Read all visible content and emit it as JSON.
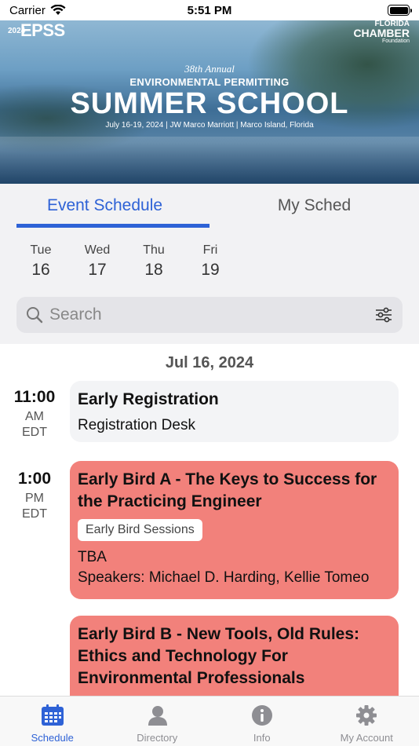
{
  "status_bar": {
    "carrier": "Carrier",
    "time": "5:51 PM"
  },
  "banner": {
    "logo_year": "2024",
    "logo_left": "EPSS",
    "logo_right_line1": "FLORIDA",
    "logo_right_line2": "CHAMBER",
    "logo_right_line3": "Foundation",
    "annual": "38th Annual",
    "subtitle": "ENVIRONMENTAL PERMITTING",
    "title": "SUMMER SCHOOL",
    "date_line": "July 16-19, 2024 | JW Marco Marriott | Marco Island, Florida"
  },
  "tabs": [
    {
      "label": "Event Schedule",
      "active": true
    },
    {
      "label": "My Sched",
      "active": false
    }
  ],
  "days": [
    {
      "name": "Tue",
      "num": "16"
    },
    {
      "name": "Wed",
      "num": "17"
    },
    {
      "name": "Thu",
      "num": "18"
    },
    {
      "name": "Fri",
      "num": "19"
    }
  ],
  "search": {
    "placeholder": "Search"
  },
  "schedule": {
    "date": "Jul 16, 2024",
    "items": [
      {
        "time": "11:00",
        "meridiem": "AM",
        "tz": "EDT",
        "title": "Early Registration",
        "location": "Registration Desk"
      },
      {
        "time": "1:00",
        "meridiem": "PM",
        "tz": "EDT",
        "title": "Early Bird A - The Keys to Success for the Practicing Engineer",
        "tag": "Early Bird Sessions",
        "location": "TBA",
        "speakers": "Speakers: Michael D. Harding, Kellie Tomeo",
        "color": "#f2817b"
      },
      {
        "title": "Early Bird B - New Tools, Old Rules: Ethics and Technology For Environmental Professionals",
        "color": "#f2817b"
      }
    ]
  },
  "tabbar": [
    {
      "label": "Schedule",
      "icon": "calendar-icon",
      "active": true
    },
    {
      "label": "Directory",
      "icon": "person-icon",
      "active": false
    },
    {
      "label": "Info",
      "icon": "info-icon",
      "active": false
    },
    {
      "label": "My Account",
      "icon": "gear-icon",
      "active": false
    }
  ],
  "colors": {
    "accent": "#2e62d6",
    "session_red": "#f2817b"
  }
}
